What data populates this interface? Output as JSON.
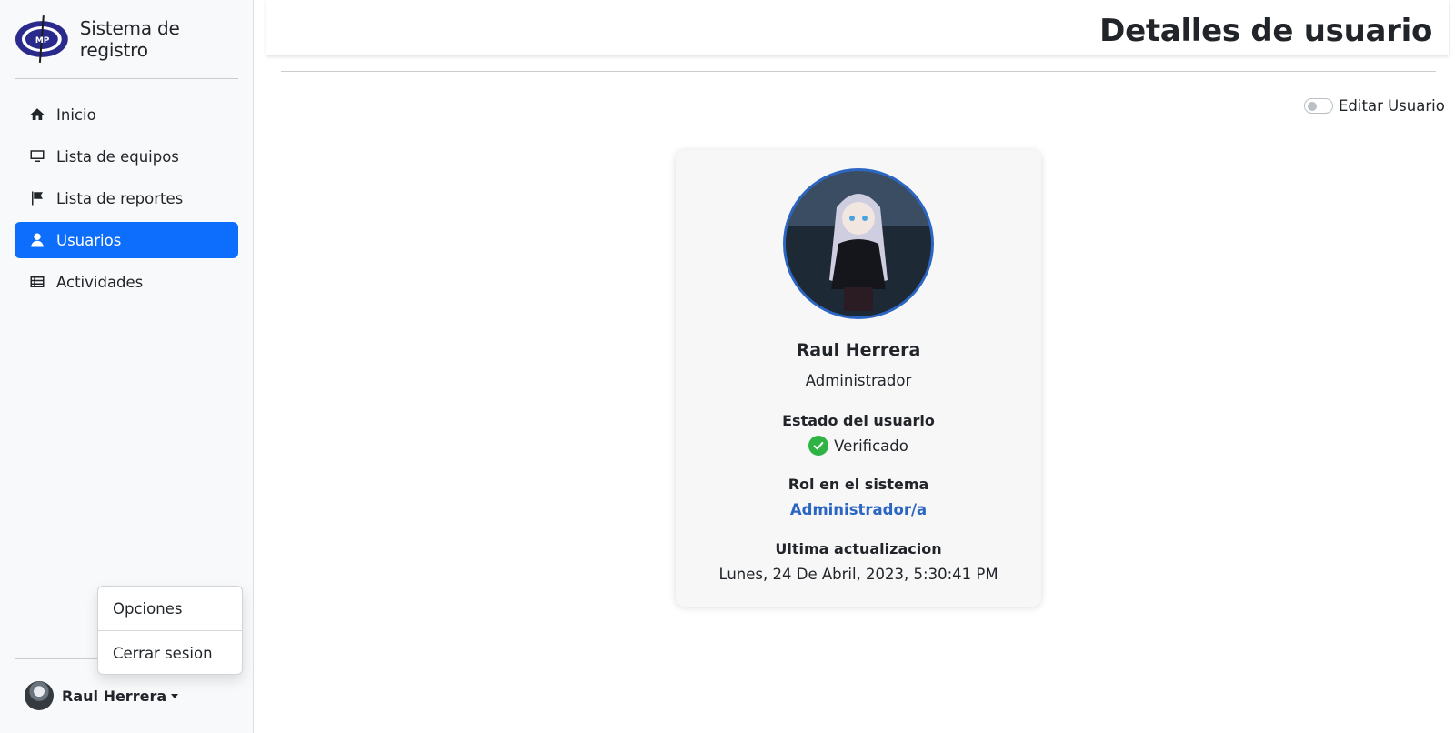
{
  "sidebar": {
    "brand_title": "Sistema de registro",
    "logo_letters": "MP",
    "items": [
      {
        "label": "Inicio",
        "icon": "home-icon",
        "active": false
      },
      {
        "label": "Lista de equipos",
        "icon": "desktop-icon",
        "active": false
      },
      {
        "label": "Lista de reportes",
        "icon": "flag-icon",
        "active": false
      },
      {
        "label": "Usuarios",
        "icon": "user-icon",
        "active": true
      },
      {
        "label": "Actividades",
        "icon": "table-list-icon",
        "active": false
      }
    ],
    "user_menu": {
      "name": "Raul Herrera",
      "options": [
        "Opciones",
        "Cerrar sesion"
      ]
    }
  },
  "header": {
    "title": "Detalles de usuario"
  },
  "edit_toggle": {
    "label": "Editar Usuario",
    "checked": false
  },
  "user_card": {
    "name": "Raul Herrera",
    "role": "Administrador",
    "status_label": "Estado del usuario",
    "status_value": "Verificado",
    "system_role_label": "Rol en el sistema",
    "system_role_value": "Administrador/a",
    "updated_label": "Ultima actualizacion",
    "updated_value": "Lunes, 24 De Abril, 2023, 5:30:41 PM"
  },
  "colors": {
    "accent": "#0d6efd",
    "link": "#2b66c3",
    "success": "#2fb344",
    "sidebar_bg": "#f8f9fa"
  }
}
